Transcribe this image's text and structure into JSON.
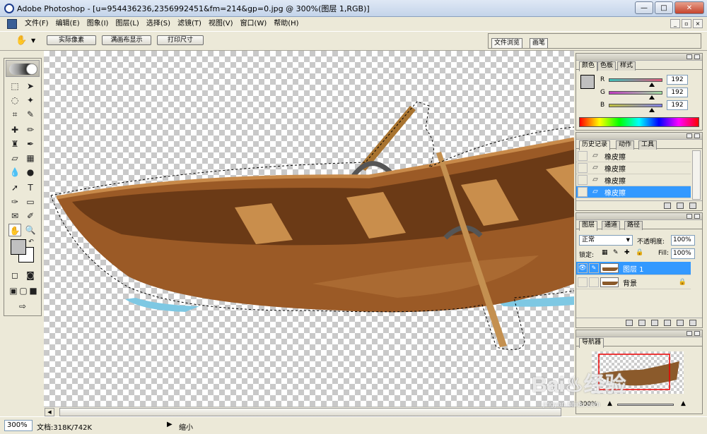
{
  "window": {
    "title": "Adobe Photoshop - [u=954436236,2356992451&fm=214&gp=0.jpg @ 300%(图层 1,RGB)]",
    "buttons": {
      "minimize": "—",
      "maximize": "□",
      "close": "✕"
    }
  },
  "menu": [
    "文件(F)",
    "编辑(E)",
    "图象(I)",
    "图层(L)",
    "选择(S)",
    "滤镜(T)",
    "视图(V)",
    "窗口(W)",
    "帮助(H)"
  ],
  "doc_buttons": {
    "minimize": "_",
    "restore": "▫",
    "close": "×"
  },
  "options": {
    "tool_icon": "hand-icon",
    "buttons": [
      "实际像素",
      "满画布显示",
      "打印尺寸"
    ]
  },
  "palette_well": {
    "tabs": [
      "文件浏览",
      "画笔"
    ]
  },
  "color_panel": {
    "tabs": [
      "颜色",
      "色板",
      "样式"
    ],
    "channels": [
      {
        "label": "R",
        "value": "192",
        "color": "#d9534f",
        "level": 0.753
      },
      {
        "label": "G",
        "value": "192",
        "color": "#9b59b6",
        "level": 0.753
      },
      {
        "label": "B",
        "value": "192",
        "color": "#7c8cd0",
        "level": 0.753
      }
    ],
    "swatch": "#c0c0c0"
  },
  "history_panel": {
    "tabs": [
      "历史记录",
      "动作",
      "工具"
    ],
    "items": [
      "橡皮擦",
      "橡皮擦",
      "橡皮擦",
      "橡皮擦"
    ],
    "selected_index": 3
  },
  "layers_panel": {
    "tabs": [
      "图层",
      "通道",
      "路径"
    ],
    "blend_mode": "正常",
    "opacity_label": "不透明度:",
    "opacity_value": "100%",
    "lock_label": "锁定:",
    "fill_label": "Fill:",
    "fill_value": "100%",
    "layers": [
      {
        "name": "图层 1",
        "selected": true
      },
      {
        "name": "背景",
        "selected": false
      }
    ]
  },
  "navigator_panel": {
    "tabs": [
      "导航器"
    ],
    "zoom": "300%"
  },
  "status": {
    "zoom": "300%",
    "doc_info": "文档:318K/742K",
    "tool_hint": "缩小",
    "arrow": "▶"
  },
  "watermark": {
    "main": "Bai♨经验",
    "sub": "jingyan.baidu.com"
  }
}
